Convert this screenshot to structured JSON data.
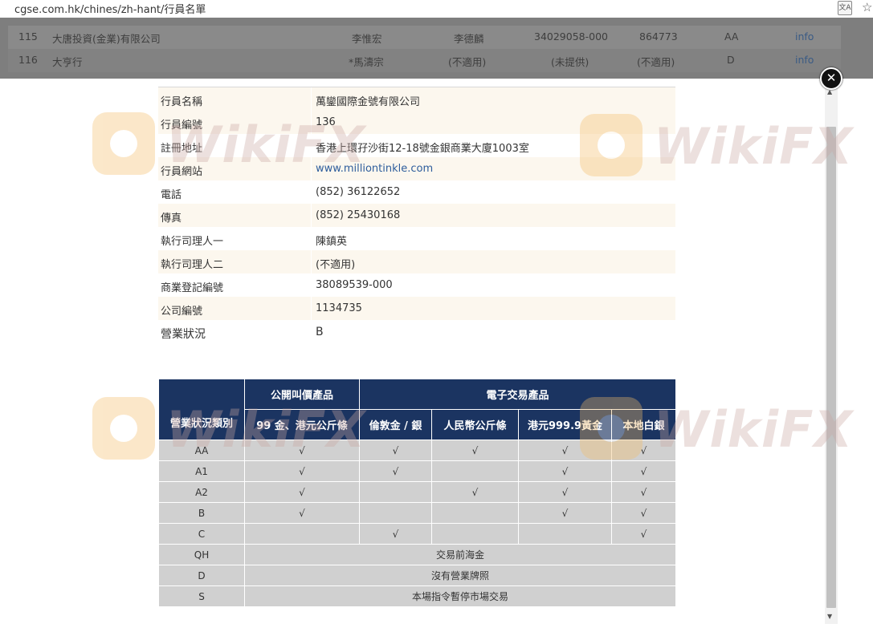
{
  "browser": {
    "url": "cgse.com.hk/chines/zh-hant/行員名單",
    "translate_icon": "translate-icon",
    "bookmark_icon": "star-icon"
  },
  "background_table": {
    "rows": [
      {
        "no": "115",
        "name": "大唐投資(金業)有限公司",
        "rep1": "李惟宏",
        "rep2": "李德麟",
        "reg": "34029058-000",
        "company_no": "864773",
        "status": "AA",
        "link": "info"
      },
      {
        "no": "116",
        "name": "大亨行",
        "rep1": "*馬濤宗",
        "rep2": "(不適用)",
        "reg": "(未提供)",
        "company_no": "(不適用)",
        "status": "D",
        "link": "info"
      }
    ]
  },
  "modal": {
    "close_icon": "close-icon",
    "details": [
      {
        "label": "行員名稱",
        "value": "萬鑾國際金號有限公司"
      },
      {
        "label": "行員編號",
        "value": "136"
      },
      {
        "label": "註冊地址",
        "value": "香港上環孖沙街12-18號金銀商業大廈1003室"
      },
      {
        "label": "行員網站",
        "value": "www.milliontinkle.com"
      },
      {
        "label": "電話",
        "value": "(852) 36122652"
      },
      {
        "label": "傳真",
        "value": "(852) 25430168"
      },
      {
        "label": "執行司理人一",
        "value": "陳鎮英"
      },
      {
        "label": "執行司理人二",
        "value": "(不適用)"
      },
      {
        "label": "商業登記編號",
        "value": "38089539-000"
      },
      {
        "label": "公司編號",
        "value": "1134735"
      },
      {
        "label": "營業狀況",
        "value": "B"
      }
    ],
    "grid": {
      "corner": "營業狀況類別",
      "group_open": "公開叫價產品",
      "group_electronic": "電子交易產品",
      "columns": [
        "99 金、港元公斤條",
        "倫敦金 / 銀",
        "人民幣公斤條",
        "港元999.9黃金",
        "本地白銀"
      ],
      "rows": [
        {
          "cat": "AA",
          "cells": [
            "√",
            "√",
            "√",
            "√",
            "√"
          ]
        },
        {
          "cat": "A1",
          "cells": [
            "√",
            "√",
            "",
            "√",
            "√"
          ]
        },
        {
          "cat": "A2",
          "cells": [
            "√",
            "",
            "√",
            "√",
            "√"
          ]
        },
        {
          "cat": "B",
          "cells": [
            "√",
            "",
            "",
            "√",
            "√"
          ]
        },
        {
          "cat": "C",
          "cells": [
            "",
            "√",
            "",
            "",
            "√"
          ]
        }
      ],
      "span_rows": [
        {
          "cat": "QH",
          "text": "交易前海金"
        },
        {
          "cat": "D",
          "text": "沒有營業牌照"
        },
        {
          "cat": "S",
          "text": "本場指令暫停市場交易"
        }
      ]
    }
  },
  "watermark": {
    "text": "WikiFX",
    "logo_icon": "wikifx-logo-icon"
  },
  "colors": {
    "header_bg": "#1b3461",
    "cell_bg": "#d0d0d0",
    "alt_row": "#fcf7ee",
    "link": "#2e5d9c"
  }
}
